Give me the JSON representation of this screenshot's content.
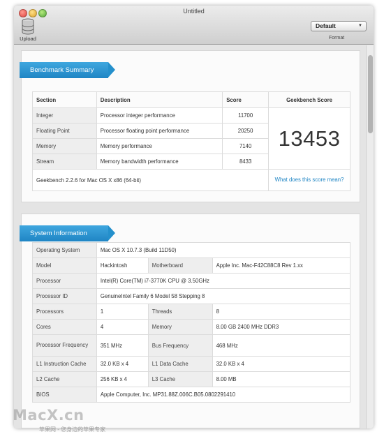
{
  "window": {
    "title": "Untitled"
  },
  "toolbar": {
    "upload_label": "Upload",
    "format_value": "Default",
    "format_label": "Format",
    "upload_icon": "database-icon",
    "caret_icon": "chevron-down-icon"
  },
  "colors": {
    "accent": "#2490cc",
    "link": "#1f85c4"
  },
  "benchmark": {
    "heading": "Benchmark Summary",
    "columns": {
      "section": "Section",
      "description": "Description",
      "score": "Score",
      "geekbench": "Geekbench Score"
    },
    "rows": [
      {
        "section": "Integer",
        "description": "Processor integer performance",
        "score": "11700"
      },
      {
        "section": "Floating Point",
        "description": "Processor floating point performance",
        "score": "20250"
      },
      {
        "section": "Memory",
        "description": "Memory performance",
        "score": "7140"
      },
      {
        "section": "Stream",
        "description": "Memory bandwidth performance",
        "score": "8433"
      }
    ],
    "geekbench_score": "13453",
    "footer": "Geekbench 2.2.6 for Mac OS X x86 (64-bit)",
    "score_link": "What does this score mean?"
  },
  "system": {
    "heading": "System Information",
    "rows": {
      "os": {
        "label": "Operating System",
        "value": "Mac OS X 10.7.3 (Build 11D50)"
      },
      "model": {
        "label": "Model",
        "value": "Hackintosh"
      },
      "motherboard": {
        "label": "Motherboard",
        "value": "Apple Inc. Mac-F42C88C8 Rev 1.xx"
      },
      "processor": {
        "label": "Processor",
        "value": "Intel(R) Core(TM) i7-3770K CPU @ 3.50GHz"
      },
      "processor_id": {
        "label": "Processor ID",
        "value": "GenuineIntel Family 6 Model 58 Stepping 8"
      },
      "processors": {
        "label": "Processors",
        "value": "1"
      },
      "threads": {
        "label": "Threads",
        "value": "8"
      },
      "cores": {
        "label": "Cores",
        "value": "4"
      },
      "memory": {
        "label": "Memory",
        "value": "8.00 GB 2400 MHz DDR3"
      },
      "proc_freq": {
        "label": "Processor Frequency",
        "value": "351 MHz"
      },
      "bus_freq": {
        "label": "Bus Frequency",
        "value": "468 MHz"
      },
      "l1i": {
        "label": "L1 Instruction Cache",
        "value": "32.0 KB x 4"
      },
      "l1d": {
        "label": "L1 Data Cache",
        "value": "32.0 KB x 4"
      },
      "l2": {
        "label": "L2 Cache",
        "value": "256 KB x 4"
      },
      "l3": {
        "label": "L3 Cache",
        "value": "8.00 MB"
      },
      "bios": {
        "label": "BIOS",
        "value": "Apple Computer, Inc. MP31.88Z.006C.B05.0802291410"
      }
    }
  },
  "watermark": {
    "brand": "MacX.cn",
    "tagline": "苹果网 - 您身边的苹果专家"
  }
}
